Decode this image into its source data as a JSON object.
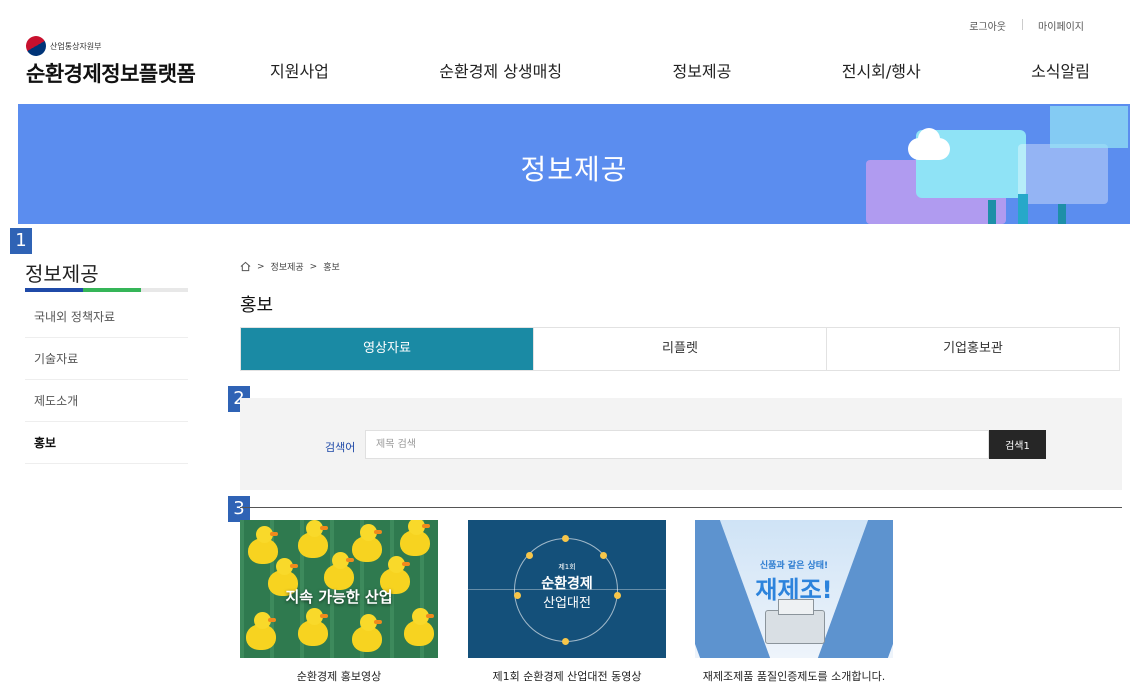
{
  "header": {
    "utility_links": [
      "로그아웃",
      "마이페이지"
    ],
    "ministry": "산업통상자원부",
    "platform_name": "순환경제정보플랫폼",
    "nav": [
      "지원사업",
      "순환경제 상생매칭",
      "정보제공",
      "전시회/행사",
      "소식알림"
    ]
  },
  "banner": {
    "title": "정보제공"
  },
  "markers": [
    "1",
    "2",
    "3"
  ],
  "sidebar": {
    "title": "정보제공",
    "items": [
      {
        "label": "국내외 정책자료",
        "active": false
      },
      {
        "label": "기술자료",
        "active": false
      },
      {
        "label": "제도소개",
        "active": false
      },
      {
        "label": "홍보",
        "active": true
      }
    ]
  },
  "breadcrumb": [
    "정보제공",
    "홍보"
  ],
  "page_title": "홍보",
  "tabs": [
    {
      "label": "영상자료",
      "active": true
    },
    {
      "label": "리플렛",
      "active": false
    },
    {
      "label": "기업홍보관",
      "active": false
    }
  ],
  "search": {
    "label": "검색어",
    "placeholder": "제목 검색",
    "button": "검색1"
  },
  "cards": [
    {
      "title": "순환경제 홍보영상",
      "thumb_text": "지속 가능한 산업"
    },
    {
      "title": "제1회 순환경제 산업대전 동영상",
      "thumb_sub": "제1회",
      "thumb_main": "순환경제",
      "thumb_main2": "산업대전"
    },
    {
      "title": "재제조제품 품질인증제도를 소개합니다.",
      "thumb_small": "신품과 같은 상태!",
      "thumb_big": "재제조!"
    }
  ],
  "colors": {
    "banner": "#5b8def",
    "tab_active": "#1a8aa4",
    "marker": "#2f63b5",
    "search_button": "#262626"
  }
}
